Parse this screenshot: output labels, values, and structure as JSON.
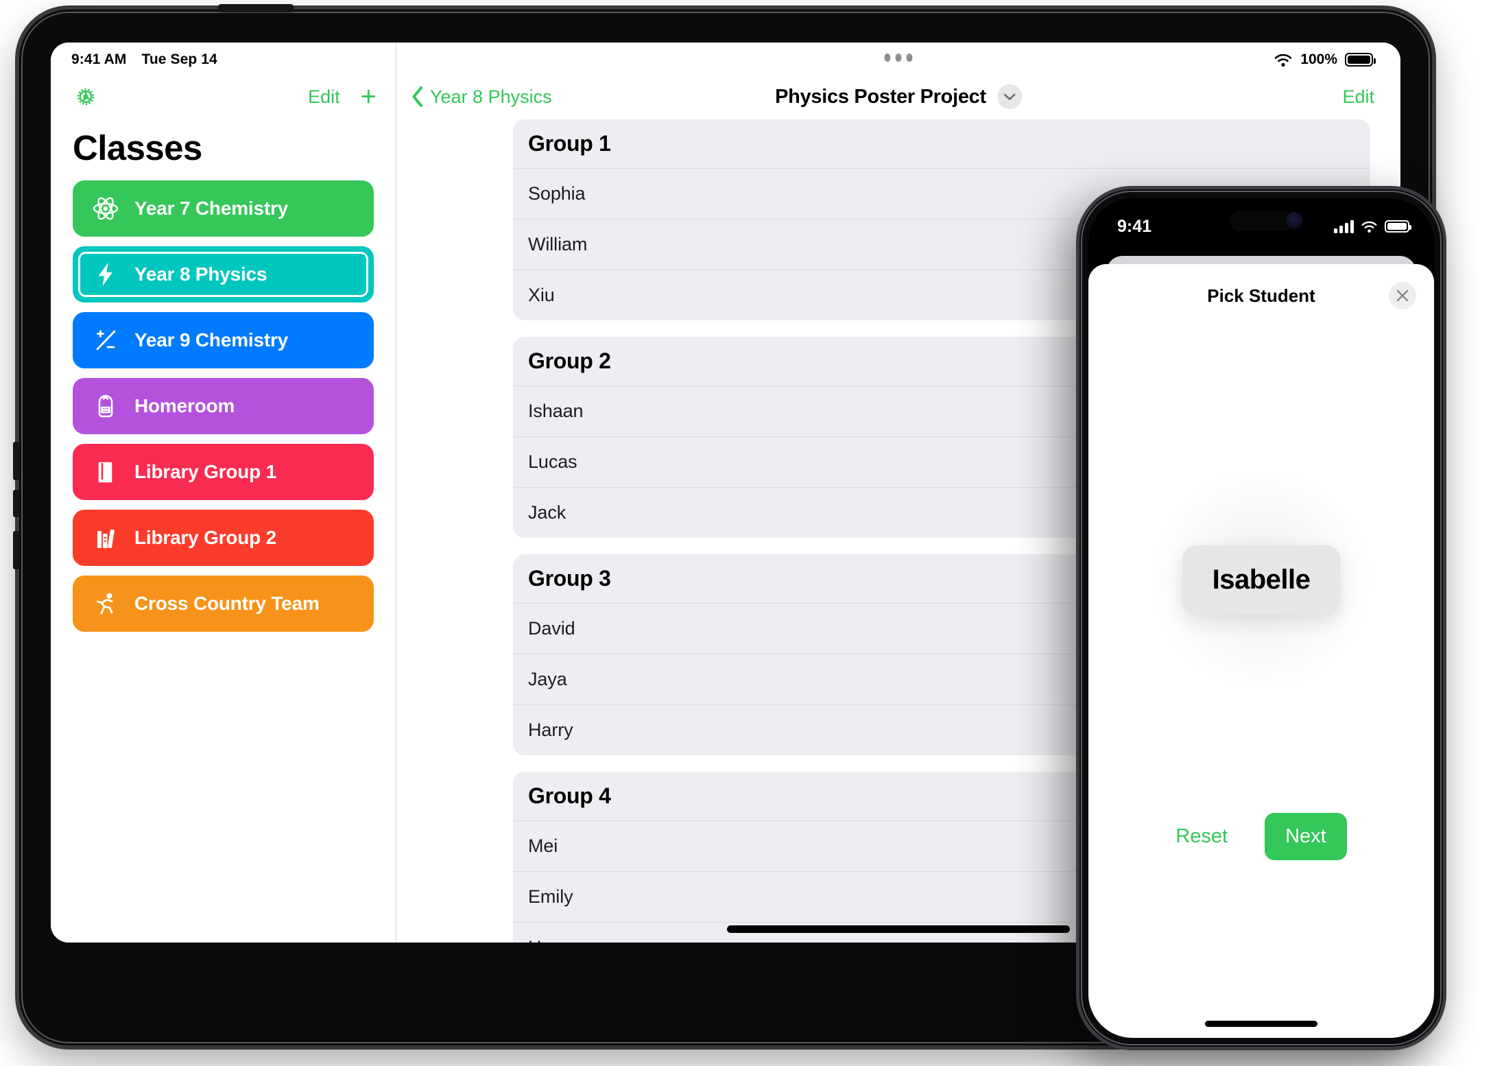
{
  "ipad": {
    "status_bar": {
      "time": "9:41 AM",
      "date": "Tue Sep 14",
      "battery_percent": "100%"
    },
    "sidebar": {
      "settings_icon": "gear-icon",
      "edit_label": "Edit",
      "add_label": "+",
      "title": "Classes",
      "items": [
        {
          "label": "Year 7 Chemistry",
          "color": "#35c759",
          "icon": "atom-icon",
          "selected": false
        },
        {
          "label": "Year 8 Physics",
          "color": "#00c7be",
          "icon": "bolt-icon",
          "selected": true
        },
        {
          "label": "Year 9 Chemistry",
          "color": "#007aff",
          "icon": "plus-minus-icon",
          "selected": false
        },
        {
          "label": "Homeroom",
          "color": "#b452dd",
          "icon": "backpack-icon",
          "selected": false
        },
        {
          "label": "Library Group 1",
          "color": "#fa2b51",
          "icon": "book-closed-icon",
          "selected": false
        },
        {
          "label": "Library Group 2",
          "color": "#fc3c2b",
          "icon": "books-vertical-icon",
          "selected": false
        },
        {
          "label": "Cross Country Team",
          "color": "#f7931a",
          "icon": "figure-run-icon",
          "selected": false
        }
      ]
    },
    "detail": {
      "back_label": "Year 8 Physics",
      "title": "Physics Poster Project",
      "title_chevron_icon": "chevron-down-icon",
      "edit_label": "Edit",
      "groups": [
        {
          "name": "Group 1",
          "students": [
            "Sophia",
            "William",
            "Xiu"
          ]
        },
        {
          "name": "Group 2",
          "students": [
            "Ishaan",
            "Lucas",
            "Jack"
          ]
        },
        {
          "name": "Group 3",
          "students": [
            "David",
            "Jaya",
            "Harry"
          ]
        },
        {
          "name": "Group 4",
          "students": [
            "Mei",
            "Emily",
            "Hao"
          ]
        }
      ]
    }
  },
  "iphone": {
    "status_bar": {
      "time": "9:41"
    },
    "sheet": {
      "title": "Pick Student",
      "close_icon": "close-icon",
      "picked_student": "Isabelle",
      "reset_label": "Reset",
      "next_label": "Next"
    }
  },
  "colors": {
    "accent_green": "#34c759",
    "card_background": "#eeeef2",
    "selected_teal": "#00c7be"
  }
}
